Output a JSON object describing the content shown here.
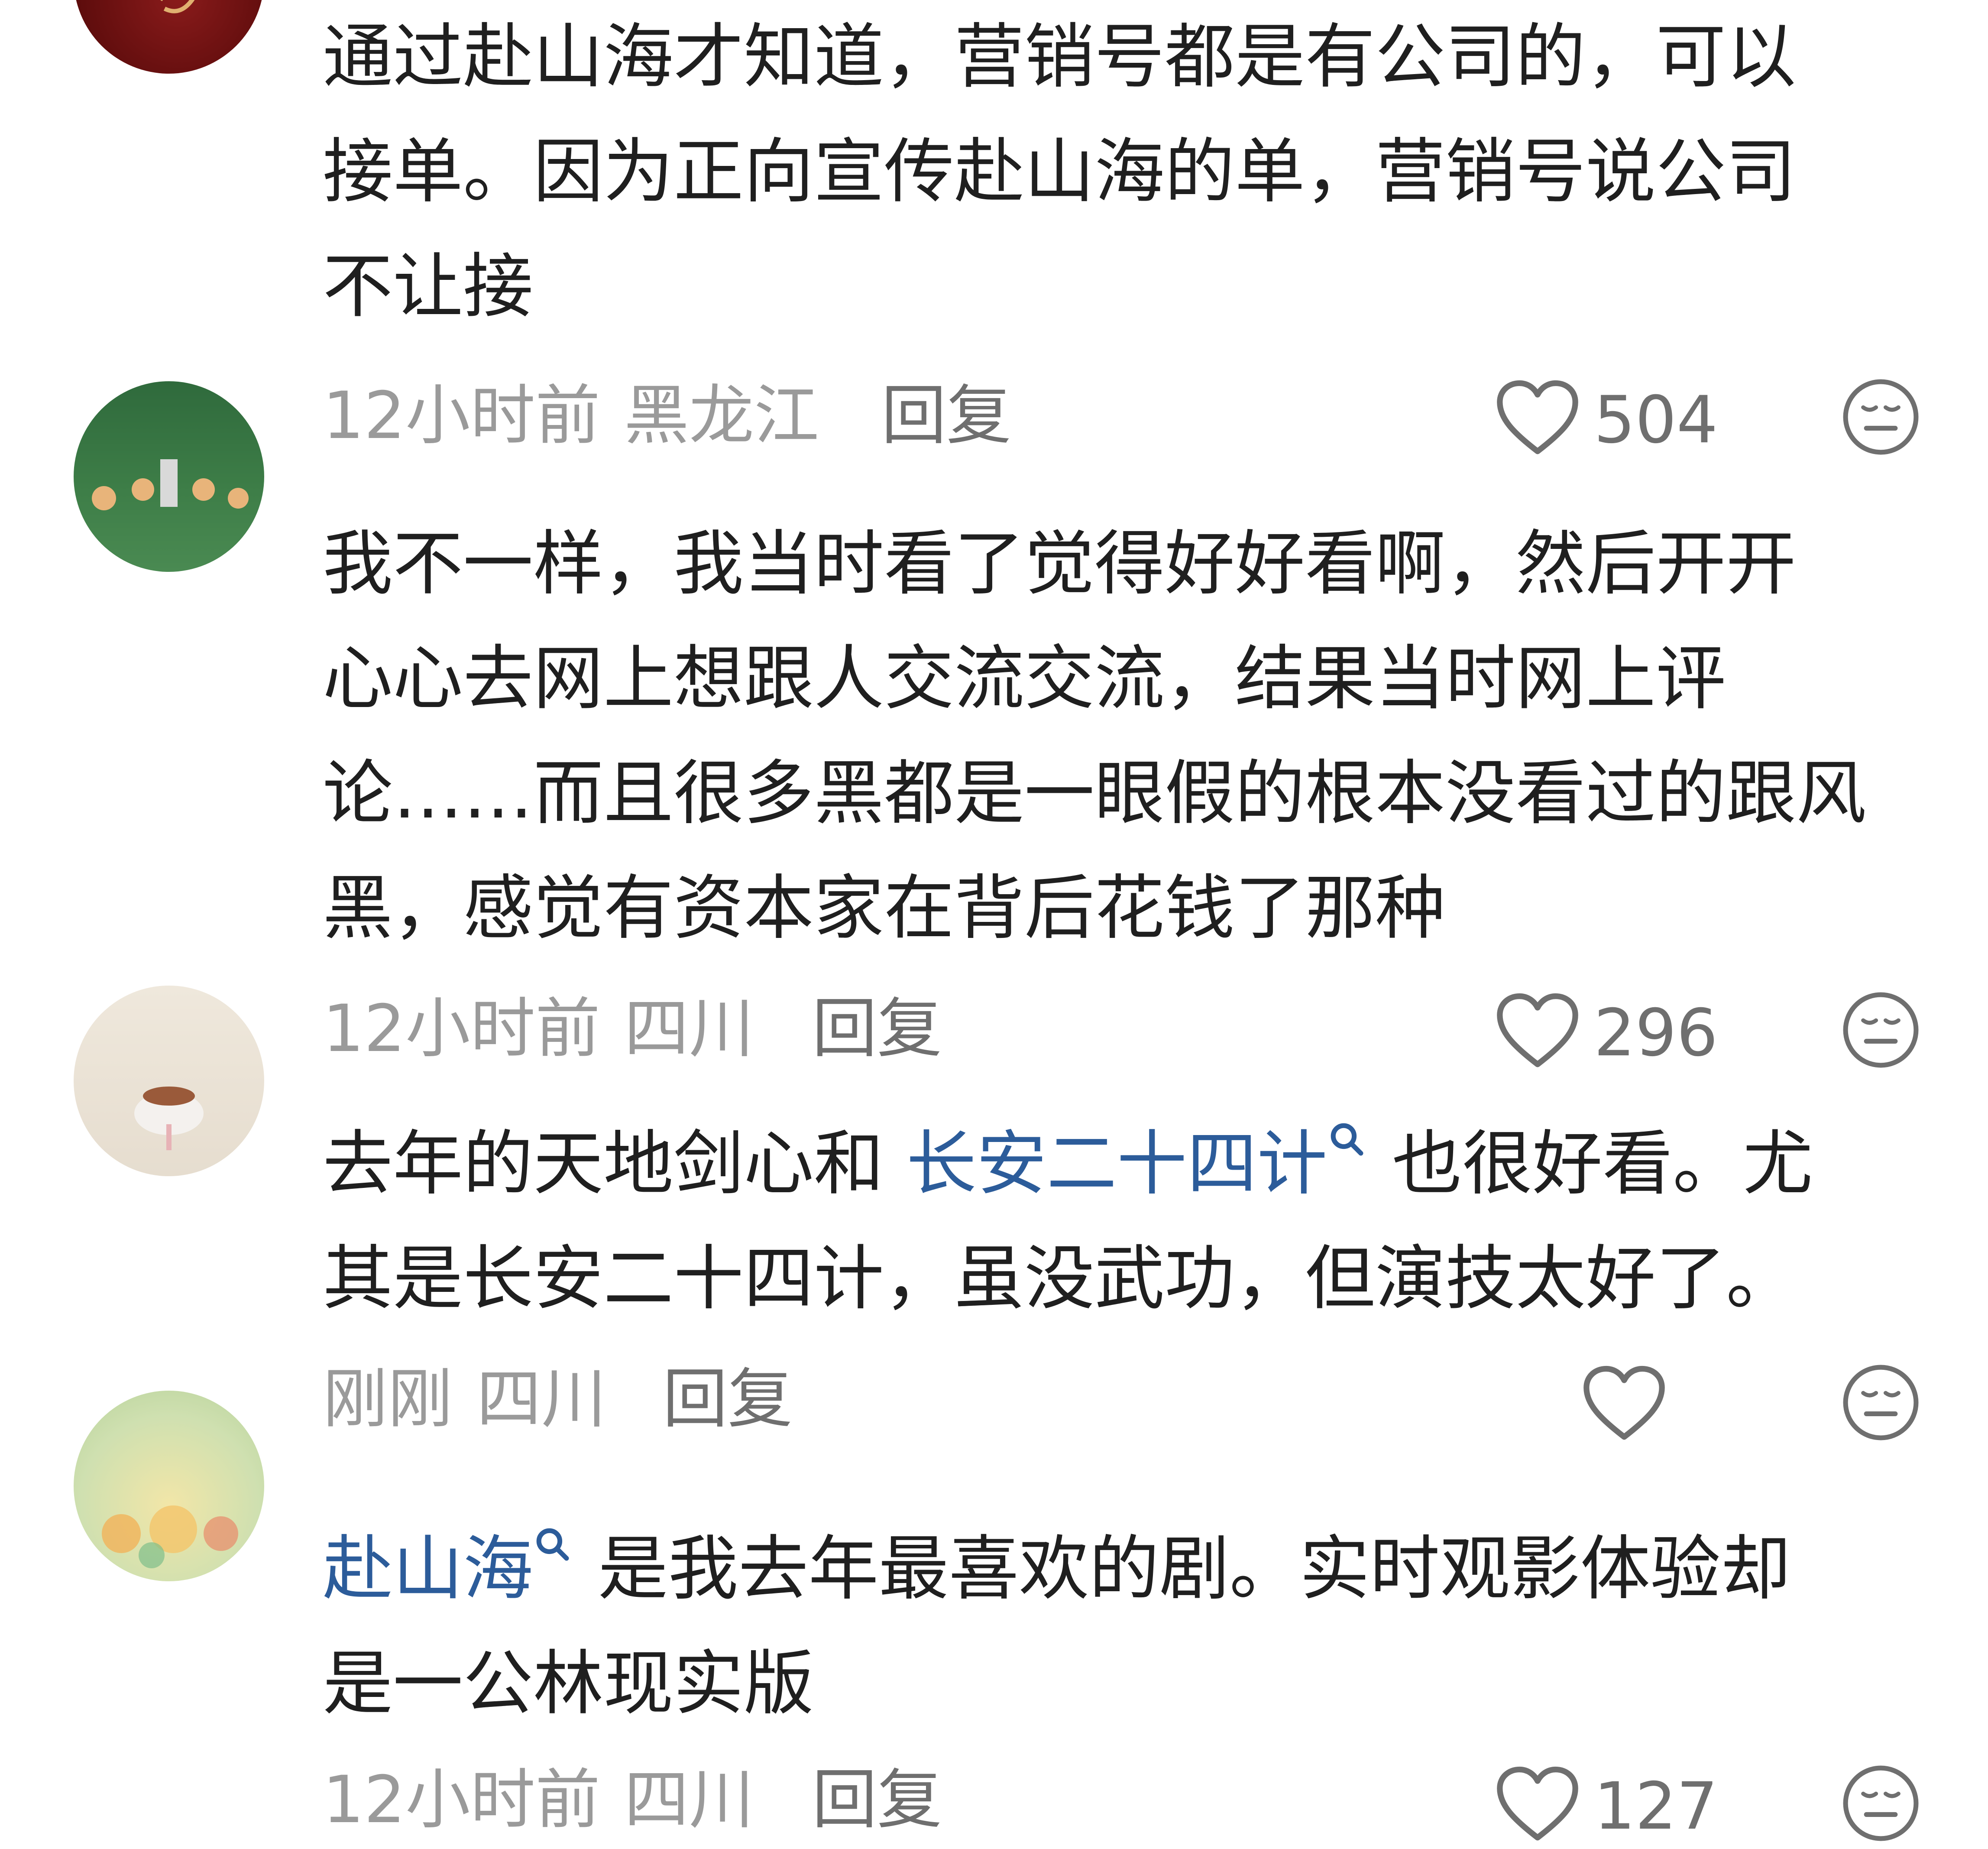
{
  "comments": [
    {
      "body_lines": [
        "通过赴山海才知道，营销号都是有公司的，可以",
        "接单。因为正向宣传赴山海的单，营销号说公司",
        "不让接"
      ],
      "time": "12小时前",
      "location": "黑龙江",
      "reply": "回复",
      "likes": "504"
    },
    {
      "body_lines": [
        "我不一样，我当时看了觉得好好看啊，然后开开",
        "心心去网上想跟人交流交流，结果当时网上评",
        "论……而且很多黑都是一眼假的根本没看过的跟风",
        "黑，感觉有资本家在背后花钱了那种"
      ],
      "time": "12小时前",
      "location": "四川",
      "reply": "回复",
      "likes": "296"
    },
    {
      "line1_before": "去年的天地剑心和 ",
      "topic": "长安二十四计",
      "line1_after": " 也很好看。尤",
      "line2": "其是长安二十四计，虽没武功，但演技太好了。",
      "time": "刚刚",
      "location": "四川",
      "reply": "回复",
      "likes": ""
    },
    {
      "topic": "赴山海",
      "line1_after": " 是我去年最喜欢的剧。实时观影体验却",
      "line2": "是一公林现实版",
      "time": "12小时前",
      "location": "四川",
      "reply": "回复",
      "likes": "127"
    }
  ],
  "icons": {
    "like": "heart-outline-icon",
    "dislike": "meh-face-icon",
    "topic": "search-icon"
  },
  "colors": {
    "topic_link": "#2c5c9a",
    "meta_text": "#9a9a9a",
    "body_text": "#1f1f1f"
  }
}
